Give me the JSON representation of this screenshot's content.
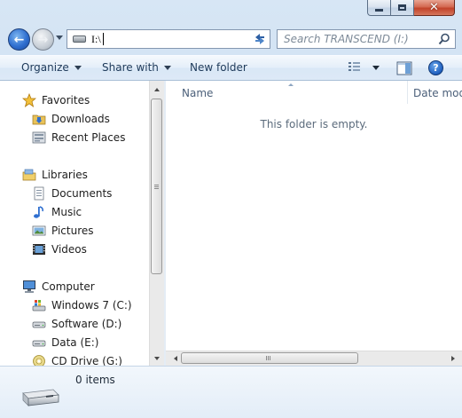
{
  "window": {
    "caption_icons": {
      "minimize": "minimize-icon",
      "maximize": "maximize-icon",
      "close": "close-icon"
    },
    "close_color": "#c7432b"
  },
  "navigation": {
    "address": "I:\\",
    "search_placeholder": "Search TRANSCEND (I:)",
    "icons": [
      "back-arrow-icon",
      "forward-arrow-icon",
      "recent-pages-icon",
      "drive-icon",
      "dropdown-icon",
      "refresh-icon",
      "search-icon"
    ]
  },
  "command_bar": {
    "organize": "Organize",
    "share_with": "Share with",
    "new_folder": "New folder",
    "icons": [
      "view-icon",
      "preview-pane-icon",
      "help-icon"
    ],
    "help_glyph": "?"
  },
  "nav_pane": {
    "favorites": {
      "label": "Favorites",
      "items": [
        {
          "label": "Downloads",
          "icon": "downloads-folder-icon"
        },
        {
          "label": "Recent Places",
          "icon": "recent-places-icon"
        }
      ]
    },
    "libraries": {
      "label": "Libraries",
      "items": [
        {
          "label": "Documents",
          "icon": "documents-icon"
        },
        {
          "label": "Music",
          "icon": "music-icon"
        },
        {
          "label": "Pictures",
          "icon": "pictures-icon"
        },
        {
          "label": "Videos",
          "icon": "videos-icon"
        }
      ]
    },
    "computer": {
      "label": "Computer",
      "items": [
        {
          "label": "Windows 7 (C:)",
          "icon": "system-drive-icon"
        },
        {
          "label": "Software (D:)",
          "icon": "hard-drive-icon"
        },
        {
          "label": "Data (E:)",
          "icon": "hard-drive-icon"
        },
        {
          "label": "CD Drive (G:)",
          "icon": "cd-drive-icon"
        }
      ]
    }
  },
  "content": {
    "columns": [
      "Name",
      "Date mod"
    ],
    "empty_message": "This folder is empty."
  },
  "details": {
    "count": "0 items",
    "icon": "removable-drive-icon"
  },
  "colors": {
    "accent": "#2f6fd0",
    "chrome": "#c8dbee",
    "command_bar": "#dde9f7"
  }
}
